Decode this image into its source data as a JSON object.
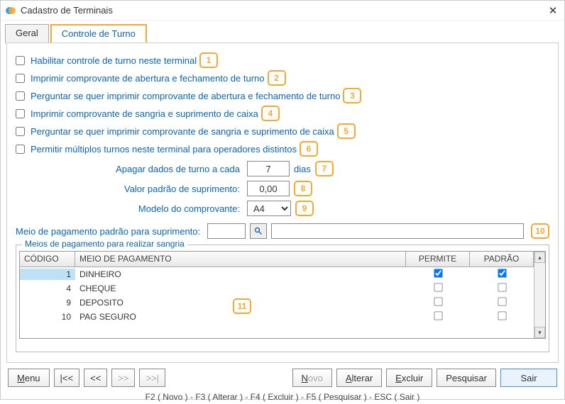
{
  "window": {
    "title": "Cadastro de Terminais"
  },
  "tabs": {
    "geral": "Geral",
    "turno": "Controle de Turno"
  },
  "checks": {
    "c1": "Habilitar controle de turno neste terminal",
    "c2": "Imprimir comprovante de abertura e fechamento de turno",
    "c3": "Perguntar se quer imprimir comprovante de abertura e fechamento de turno",
    "c4": "Imprimir comprovante de sangria e suprimento de caixa",
    "c5": "Perguntar se quer imprimir comprovante de sangria e suprimento de caixa",
    "c6": "Permitir múltiplos turnos neste terminal para operadores distintos"
  },
  "fields": {
    "apagar_lbl": "Apagar dados de turno a cada",
    "apagar_val": "7",
    "dias": "dias",
    "valor_lbl": "Valor padrão de suprimento:",
    "valor_val": "0,00",
    "modelo_lbl": "Modelo do comprovante:",
    "modelo_val": "A4",
    "meio_lbl": "Meio de pagamento padrão para suprimento:",
    "meio_code": "",
    "meio_desc": ""
  },
  "badges": {
    "b1": "1",
    "b2": "2",
    "b3": "3",
    "b4": "4",
    "b5": "5",
    "b6": "6",
    "b7": "7",
    "b8": "8",
    "b9": "9",
    "b10": "10",
    "b11": "11"
  },
  "grid": {
    "title": "Meios de pagamento para realizar sangria",
    "head": {
      "code": "CÓDIGO",
      "name": "MEIO DE PAGAMENTO",
      "perm": "PERMITE",
      "def": "PADRÃO"
    },
    "rows": [
      {
        "code": "1",
        "name": "DINHEIRO",
        "perm": true,
        "def": true
      },
      {
        "code": "4",
        "name": "CHEQUE",
        "perm": false,
        "def": false
      },
      {
        "code": "9",
        "name": "DEPOSITO",
        "perm": false,
        "def": false
      },
      {
        "code": "10",
        "name": "PAG SEGURO",
        "perm": false,
        "def": false
      }
    ]
  },
  "buttons": {
    "menu": "Menu",
    "first": "|<<",
    "prev": "<<",
    "next": ">>",
    "last": ">>|",
    "novo": "Novo",
    "alterar": "Alterar",
    "excluir": "Excluir",
    "pesq": "Pesquisar",
    "sair": "Sair"
  },
  "status": "F2 ( Novo )  -  F3 ( Alterar )  -  F4 ( Excluir )  -  F5 ( Pesquisar )  -  ESC ( Sair )"
}
